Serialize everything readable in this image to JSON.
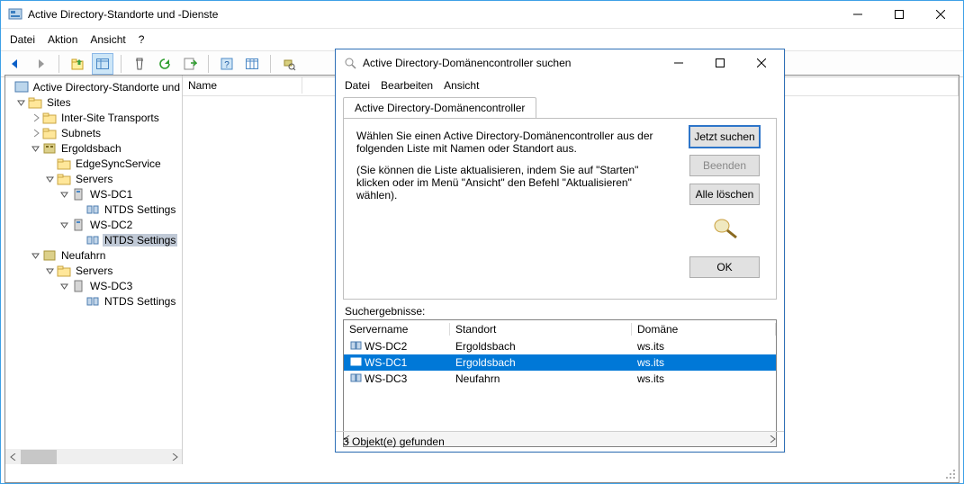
{
  "window": {
    "title": "Active Directory-Standorte und -Dienste",
    "menus": [
      "Datei",
      "Aktion",
      "Ansicht",
      "?"
    ]
  },
  "tree": {
    "root": "Active Directory-Standorte und",
    "sites": "Sites",
    "ist": "Inter-Site Transports",
    "subnets": "Subnets",
    "site1": "Ergoldsbach",
    "edge": "EdgeSyncService",
    "servers1": "Servers",
    "dc1": "WS-DC1",
    "ntds1": "NTDS Settings",
    "dc2": "WS-DC2",
    "ntds2": "NTDS Settings",
    "site2": "Neufahrn",
    "servers2": "Servers",
    "dc3": "WS-DC3",
    "ntds3": "NTDS Settings"
  },
  "list": {
    "col0": "Name"
  },
  "dialog": {
    "title": "Active Directory-Domänencontroller suchen",
    "menus": [
      "Datei",
      "Bearbeiten",
      "Ansicht"
    ],
    "tab": "Active Directory-Domänencontroller",
    "instruction": "Wählen Sie einen Active Directory-Domänencontroller aus der folgenden Liste mit Namen oder Standort aus.",
    "note": "(Sie können die Liste aktualisieren, indem Sie auf \"Starten\" klicken oder im Menü \"Ansicht\" den Befehl \"Aktualisieren\" wählen).",
    "buttons": {
      "search": "Jetzt suchen",
      "stop": "Beenden",
      "clear": "Alle löschen",
      "ok": "OK"
    },
    "results_label": "Suchergebnisse:",
    "cols": {
      "server": "Servername",
      "site": "Standort",
      "domain": "Domäne"
    },
    "rows": [
      {
        "server": "WS-DC2",
        "site": "Ergoldsbach",
        "domain": "ws.its",
        "selected": false
      },
      {
        "server": "WS-DC1",
        "site": "Ergoldsbach",
        "domain": "ws.its",
        "selected": true
      },
      {
        "server": "WS-DC3",
        "site": "Neufahrn",
        "domain": "ws.its",
        "selected": false
      }
    ],
    "status": "3 Objekt(e) gefunden"
  }
}
